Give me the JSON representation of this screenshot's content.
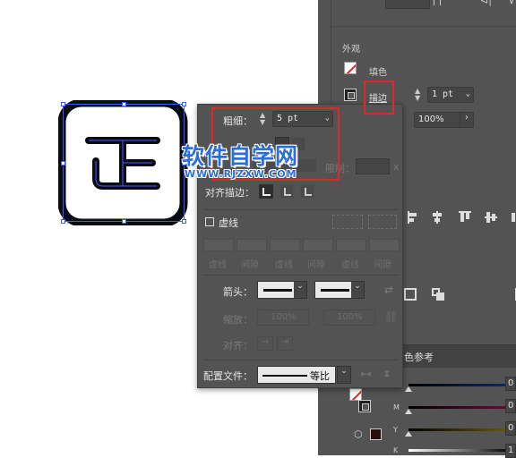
{
  "appearance": {
    "section_title": "外观",
    "fill_label": "填色",
    "stroke_label": "描边",
    "stroke_weight": "1 pt",
    "opacity": "100%"
  },
  "stroke_panel": {
    "weight_label": "粗细：",
    "weight_value": "5 pt",
    "limit_label": "限制：",
    "limit_suffix": "x",
    "align_label": "对齐描边：",
    "dashed_label": "虚线",
    "dash_labels": [
      "虚线",
      "间隙",
      "虚线",
      "间隙",
      "虚线",
      "间隙"
    ],
    "arrow_label": "箭头：",
    "scale_label": "缩放：",
    "scale_start": "100%",
    "scale_end": "100%",
    "align_arrow_label": "对齐：",
    "profile_label": "配置文件：",
    "profile_value": "等比"
  },
  "watermark": {
    "title": "软件自学网",
    "url": "WWW.RJZXW.COM"
  },
  "color_guide_tab": "色参考",
  "color_panel": {
    "channel_labels": [
      "",
      "M",
      "Y",
      "K"
    ],
    "values": [
      "0",
      "0",
      "0",
      "1"
    ]
  },
  "colors": {
    "panel_bg": "#535353",
    "highlight_red": "#e0282a",
    "watermark_blue": "#2b6fd6",
    "selection_blue": "#3a5cff"
  }
}
